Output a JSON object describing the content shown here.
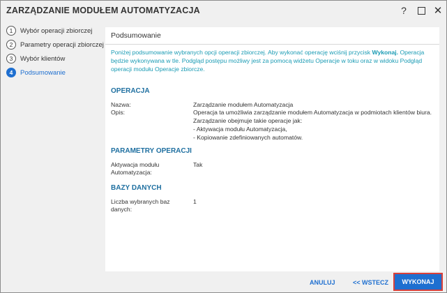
{
  "window": {
    "title": "ZARZĄDZANIE MODUŁEM AUTOMATYZACJA",
    "help_glyph": "?",
    "close_glyph": "✕"
  },
  "steps": [
    {
      "num": "1",
      "label": "Wybór operacji zbiorczej",
      "active": false
    },
    {
      "num": "2",
      "label": "Parametry operacji zbiorczej",
      "active": false
    },
    {
      "num": "3",
      "label": "Wybór klientów",
      "active": false
    },
    {
      "num": "4",
      "label": "Podsumowanie",
      "active": true
    }
  ],
  "content": {
    "title": "Podsumowanie",
    "intro_part1": "Poniżej podsumowanie wybranych opcji operacji zbiorczej. Aby wykonać operację wciśnij przycisk ",
    "intro_bold": "Wykonaj.",
    "intro_part2": " Operacja będzie wykonywana w tle. Podgląd postępu możliwy jest za pomocą widżetu Operacje w toku oraz w widoku Podgląd operacji modułu Operacje zbiorcze."
  },
  "operacja": {
    "heading": "OPERACJA",
    "name_label": "Nazwa:",
    "name_value": "Zarządzanie modułem Automatyzacja",
    "desc_label": "Opis:",
    "desc_line1": "Operacja ta umożliwia zarządzanie modułem Automatyzacja w podmiotach klientów biura.",
    "desc_line2": "Zarządzanie obejmuje takie operacje jak:",
    "desc_line3": "- Aktywacja modułu Automatyzacja,",
    "desc_line4": "- Kopiowanie zdefiniowanych automatów."
  },
  "parametry": {
    "heading": "PARAMETRY OPERACJI",
    "label_line1": "Aktywacja modułu",
    "label_line2": "Automatyzacja:",
    "value": "Tak"
  },
  "bazy": {
    "heading": "BAZY DANYCH",
    "label_line1": "Liczba wybranych baz",
    "label_line2": "danych:",
    "value": "1"
  },
  "footer": {
    "cancel_label": "ANULUJ",
    "back_label": "<< WSTECZ",
    "execute_label": "WYKONAJ"
  },
  "colors": {
    "accent": "#1e6fd0",
    "intro_text": "#1a9bb4",
    "section_heading": "#1e6fa0",
    "execute_outline": "#d9403a"
  }
}
